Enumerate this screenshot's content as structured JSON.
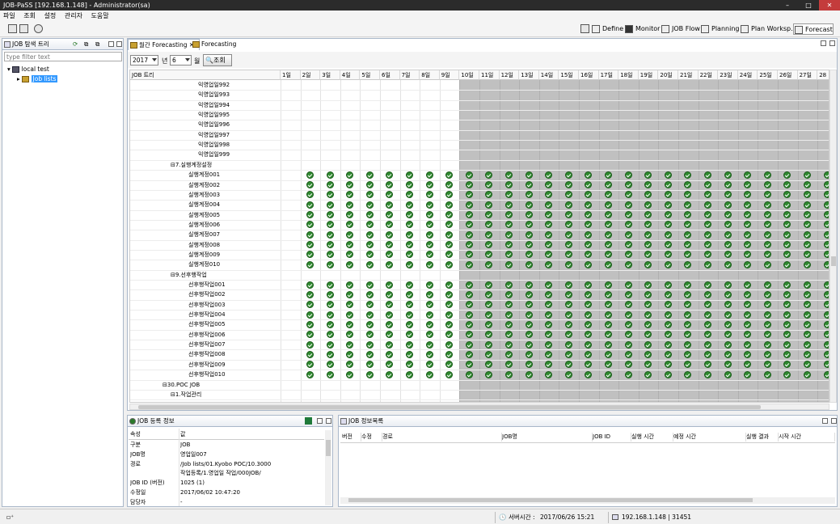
{
  "window": {
    "title": "JOB-PaSS [192.168.1.148] - Administrator(sa)"
  },
  "menu": [
    "파일",
    "조회",
    "설정",
    "관리자",
    "도움말"
  ],
  "perspectives": [
    "Define",
    "Monitor",
    "JOB Flow",
    "Planning",
    "Plan Worksp...",
    "Forecastin"
  ],
  "left_panel": {
    "title": "JOB 탐색 트리",
    "filter_placeholder": "type filter text",
    "tree": [
      {
        "label": "local test"
      },
      {
        "label": "Job lists"
      }
    ]
  },
  "editor_tabs": [
    "월간 Forecasting",
    "Forecasting"
  ],
  "controls": {
    "year": "2017",
    "year_unit": "년",
    "month": "6",
    "month_unit": "월",
    "search_label": "조회"
  },
  "grid": {
    "tree_header": "JOB 트리",
    "days": [
      "1일",
      "2일",
      "3일",
      "4일",
      "5일",
      "6일",
      "7일",
      "8일",
      "9일",
      "10일",
      "11일",
      "12일",
      "13일",
      "14일",
      "15일",
      "16일",
      "17일",
      "18일",
      "19일",
      "20일",
      "21일",
      "22일",
      "23일",
      "24일",
      "25일",
      "26일",
      "27일",
      "28"
    ],
    "rows": [
      {
        "label": "익영업일992",
        "indent": 3,
        "checks": false
      },
      {
        "label": "익영업일993",
        "indent": 3,
        "checks": false
      },
      {
        "label": "익영업일994",
        "indent": 3,
        "checks": false
      },
      {
        "label": "익영업일995",
        "indent": 3,
        "checks": false
      },
      {
        "label": "익영업일996",
        "indent": 3,
        "checks": false
      },
      {
        "label": "익영업일997",
        "indent": 3,
        "checks": false
      },
      {
        "label": "익영업일998",
        "indent": 3,
        "checks": false
      },
      {
        "label": "익영업일999",
        "indent": 3,
        "checks": false
      },
      {
        "label": "⊟7.실행계정설정",
        "indent": 2,
        "checks": false
      },
      {
        "label": "실행계정001",
        "indent": 3,
        "checks": true
      },
      {
        "label": "실행계정002",
        "indent": 3,
        "checks": true
      },
      {
        "label": "실행계정003",
        "indent": 3,
        "checks": true
      },
      {
        "label": "실행계정004",
        "indent": 3,
        "checks": true
      },
      {
        "label": "실행계정005",
        "indent": 3,
        "checks": true
      },
      {
        "label": "실행계정006",
        "indent": 3,
        "checks": true
      },
      {
        "label": "실행계정007",
        "indent": 3,
        "checks": true
      },
      {
        "label": "실행계정008",
        "indent": 3,
        "checks": true
      },
      {
        "label": "실행계정009",
        "indent": 3,
        "checks": true
      },
      {
        "label": "실행계정010",
        "indent": 3,
        "checks": true
      },
      {
        "label": "⊟9.선후행작업",
        "indent": 2,
        "checks": false
      },
      {
        "label": "선후행작업001",
        "indent": 3,
        "checks": true
      },
      {
        "label": "선후행작업002",
        "indent": 3,
        "checks": true
      },
      {
        "label": "선후행작업003",
        "indent": 3,
        "checks": true
      },
      {
        "label": "선후행작업004",
        "indent": 3,
        "checks": true
      },
      {
        "label": "선후행작업005",
        "indent": 3,
        "checks": true
      },
      {
        "label": "선후행작업006",
        "indent": 3,
        "checks": true
      },
      {
        "label": "선후행작업007",
        "indent": 3,
        "checks": true
      },
      {
        "label": "선후행작업008",
        "indent": 3,
        "checks": true
      },
      {
        "label": "선후행작업009",
        "indent": 3,
        "checks": true
      },
      {
        "label": "선후행작업010",
        "indent": 3,
        "checks": true
      },
      {
        "label": "⊟30.POC JOB",
        "indent": 1,
        "checks": false
      },
      {
        "label": "⊟1.작업관리",
        "indent": 2,
        "checks": false
      }
    ]
  },
  "job_info": {
    "title": "JOB 등록 정보",
    "headers": [
      "속성",
      "값"
    ],
    "rows": [
      {
        "k": "구분",
        "v": "JOB"
      },
      {
        "k": "JOB명",
        "v": "영업일007"
      },
      {
        "k": "경로",
        "v": "/Job lists/01.Kyobo POC/10.3000"
      },
      {
        "k": "",
        "v": "작업등록/1.영업일 작업/000JOB/"
      },
      {
        "k": "JOB ID (버전)",
        "v": "1025 (1)"
      },
      {
        "k": "수정일",
        "v": "2017/06/02 10:47:20"
      },
      {
        "k": "담당자",
        "v": "-"
      }
    ]
  },
  "job_list": {
    "title": "JOB 정보목록",
    "headers": [
      "버전",
      "수정",
      "경로",
      "JOB명",
      "JOB ID",
      "실행 시간",
      "예정 시간",
      "실행 결과",
      "시작 시간"
    ]
  },
  "status": {
    "server_time_label": "서버시간 :",
    "server_time": "2017/06/26 15:21",
    "connection": "192.168.1.148 | 31451"
  },
  "colors": {
    "check": "#2f8a2f",
    "future_grey": "#c0c0c0",
    "selection": "#3399ff"
  }
}
